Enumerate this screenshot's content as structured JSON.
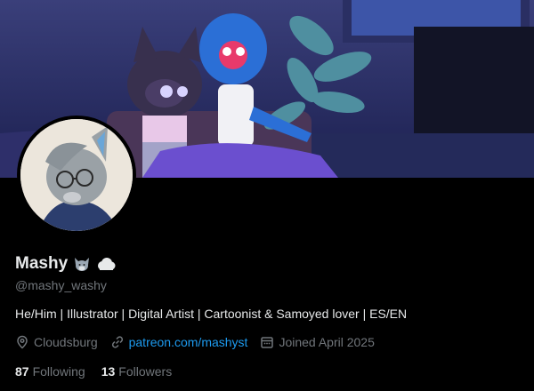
{
  "profile": {
    "display_name": "Mashy",
    "handle": "@mashy_washy",
    "bio": "He/Him | Illustrator | Digital Artist | Cartoonist & Samoyed lover | ES/EN",
    "location": "Cloudsburg",
    "website": "patreon.com/mashyst",
    "joined": "Joined April 2025",
    "following_count": "87",
    "following_label": "Following",
    "followers_count": "13",
    "followers_label": "Followers"
  },
  "icons": {
    "name_emojis": [
      "wolf-face-icon",
      "cloud-icon"
    ],
    "location": "location-pin-icon",
    "website": "link-icon",
    "joined": "calendar-icon"
  },
  "colors": {
    "background": "#000000",
    "text": "#e7e9ea",
    "muted": "#71767b",
    "link": "#1d9bf0"
  }
}
